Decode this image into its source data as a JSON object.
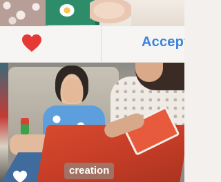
{
  "actions": {
    "accept_label": "Accept"
  },
  "photo": {
    "caption": "creation"
  },
  "icons": {
    "like": "heart-icon",
    "overlay_like": "heart-icon"
  },
  "colors": {
    "heart": "#e53935",
    "accept_text": "#3b84d9",
    "caption_bg": "#a07668"
  }
}
